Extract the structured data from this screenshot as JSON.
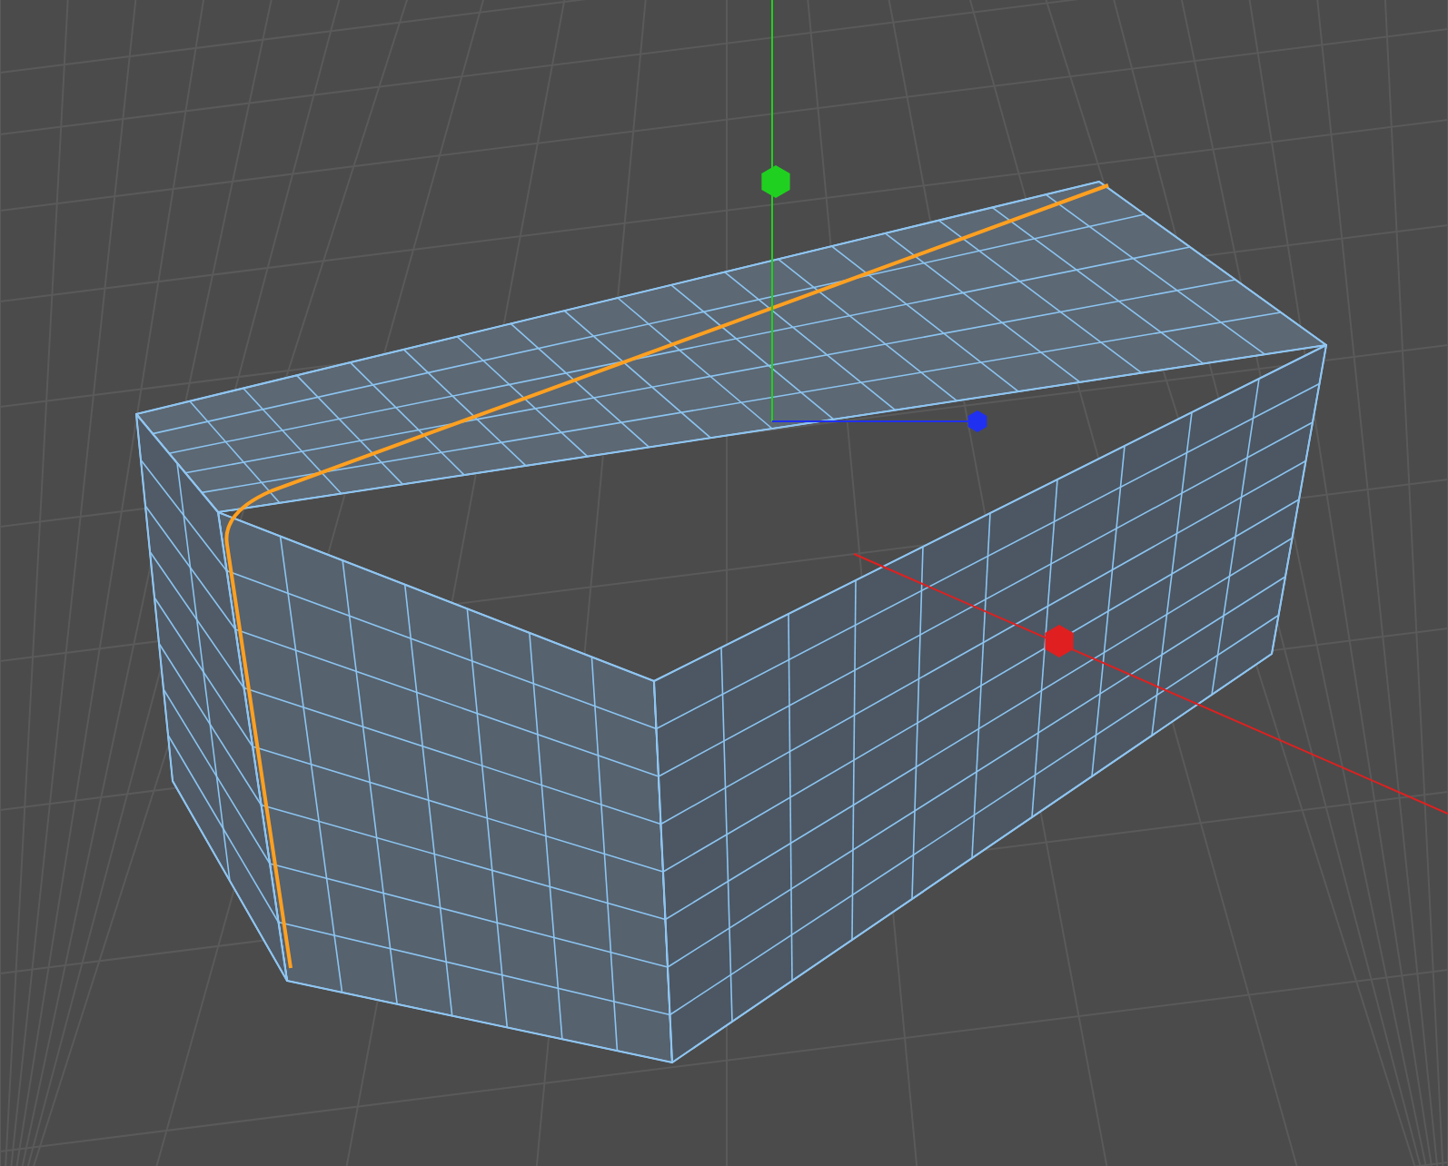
{
  "viewport": {
    "gizmo_axes": [
      {
        "kind": "x",
        "color": "#e02020"
      },
      {
        "kind": "y",
        "color": "#20d020"
      },
      {
        "kind": "z",
        "color": "#2030f0"
      }
    ]
  }
}
